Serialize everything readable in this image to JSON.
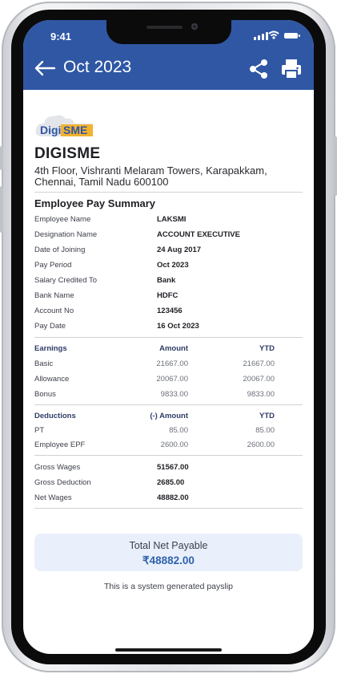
{
  "status_bar": {
    "time": "9:41"
  },
  "header": {
    "title": "Oct 2023",
    "back_icon": "arrow-left-icon",
    "share_icon": "share-icon",
    "print_icon": "print-icon"
  },
  "colors": {
    "header": "#2f57a4",
    "accent": "#2f62ac",
    "total_bg": "#e9f0fb",
    "logo_yellow": "#f2b230"
  },
  "company": {
    "logo_text_a": "Digi",
    "logo_text_b": "SME",
    "name": "DIGISME",
    "address": "4th Floor, Vishranti Melaram Towers, Karapakkam, Chennai, Tamil Nadu 600100"
  },
  "summary": {
    "title": "Employee Pay Summary",
    "rows": [
      {
        "label": "Employee Name",
        "value": "LAKSMI"
      },
      {
        "label": "Designation Name",
        "value": "ACCOUNT EXECUTIVE"
      },
      {
        "label": "Date of Joining",
        "value": "24 Aug 2017"
      },
      {
        "label": "Pay Period",
        "value": "Oct 2023"
      },
      {
        "label": "Salary Credited To",
        "value": "Bank"
      },
      {
        "label": "Bank Name",
        "value": "HDFC"
      },
      {
        "label": "Account No",
        "value": "123456"
      },
      {
        "label": "Pay Date",
        "value": "16 Oct 2023"
      }
    ]
  },
  "earnings": {
    "header": {
      "label": "Earnings",
      "amount": "Amount",
      "ytd": "YTD"
    },
    "rows": [
      {
        "label": "Basic",
        "amount": "21667.00",
        "ytd": "21667.00"
      },
      {
        "label": "Allowance",
        "amount": "20067.00",
        "ytd": "20067.00"
      },
      {
        "label": "Bonus",
        "amount": "9833.00",
        "ytd": "9833.00"
      }
    ]
  },
  "deductions": {
    "header": {
      "label": "Deductions",
      "amount": "(-) Amount",
      "ytd": "YTD"
    },
    "rows": [
      {
        "label": "PT",
        "amount": "85.00",
        "ytd": "85.00"
      },
      {
        "label": "Employee EPF",
        "amount": "2600.00",
        "ytd": "2600.00"
      }
    ]
  },
  "totals": {
    "rows": [
      {
        "label": "Gross Wages",
        "value": "51567.00"
      },
      {
        "label": "Gross Deduction",
        "value": "2685.00"
      },
      {
        "label": "Net Wages",
        "value": "48882.00"
      }
    ]
  },
  "net_payable": {
    "label": "Total Net Payable",
    "value": "₹48882.00"
  },
  "footer_note": "This is a system generated payslip"
}
